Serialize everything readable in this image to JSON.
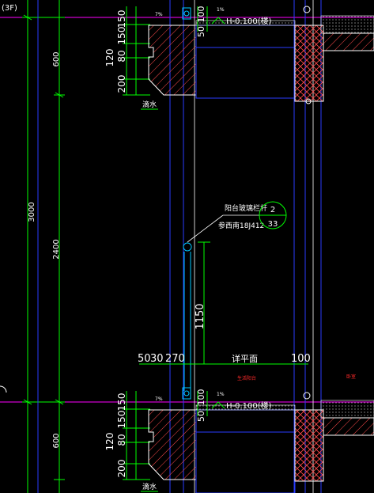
{
  "colors": {
    "background": "#000000",
    "dim_green": "#00ff00",
    "outline_blue": "#2a3cff",
    "cyan": "#00c8ff",
    "magenta": "#ff00ff",
    "white": "#ffffff",
    "wall_hatch": "#ff4a4a",
    "red": "#ff2a2a"
  },
  "corner_label": "(3F)",
  "top_floor_tag": "3F",
  "dimensions_left": {
    "d3000": "3000",
    "d600_top": "600",
    "d2400": "2400",
    "d600_bottom": "600"
  },
  "dimensions_slab_top": {
    "d150a": "150",
    "d150b": "150",
    "d120": "120",
    "d80": "80",
    "d200": "200",
    "d50": "50",
    "d100": "100"
  },
  "dimensions_slab_bottom": {
    "d150a": "150",
    "d150b": "150",
    "d120": "120",
    "d80": "80",
    "d200": "200",
    "d50": "50",
    "d100": "100"
  },
  "level_top": "H-0.100(楼)",
  "level_bottom": "H-0.100(楼)",
  "slope_top": "1%",
  "slope_bottom": "1%",
  "drip_top": "滴水",
  "drip_bottom": "滴水",
  "railing_note": "阳台玻璃栏杆",
  "railing_ref": "参西南18J412",
  "detail_callout": {
    "top": "2",
    "bottom": "33"
  },
  "dim_1150": "1150",
  "dim_bottom_row": {
    "d50": "50",
    "d30": "30",
    "d270": "270",
    "plan_label": "详平面",
    "d100": "100"
  },
  "small_red_label": "生活阳台",
  "small_red_label_right": "卧室",
  "slope_note_top": "7%",
  "slope_note_bottom": "7%"
}
